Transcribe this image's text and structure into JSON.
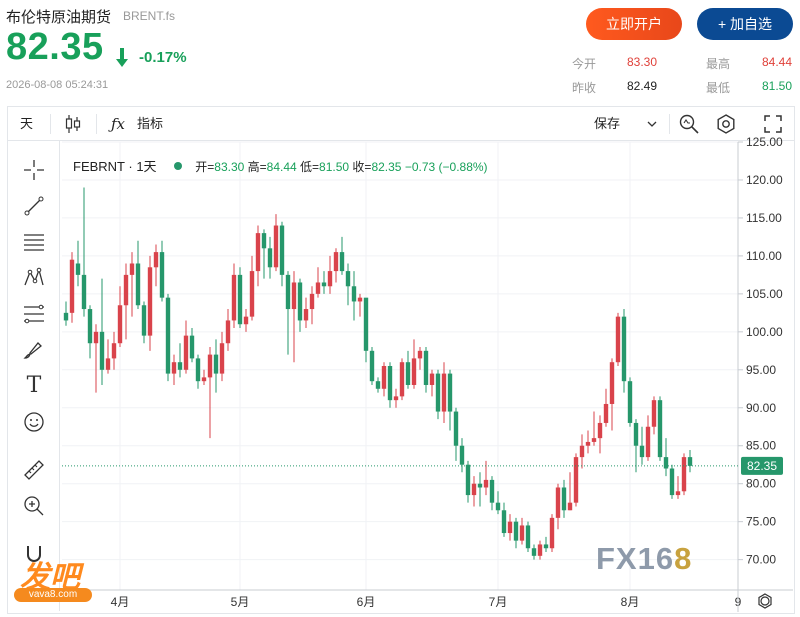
{
  "header": {
    "name": "布伦特原油期货",
    "code": "BRENT.fs",
    "price": "82.35",
    "change_pct": "-0.17%",
    "timestamp": "2026-08-08 05:24:31",
    "open_button": "立即开户",
    "watch_button": "+ 加自选"
  },
  "quote": {
    "open_label": "今开",
    "open": "83.30",
    "prev_label": "昨收",
    "prev": "82.49",
    "high_label": "最高",
    "high": "84.44",
    "low_label": "最低",
    "low": "81.50"
  },
  "toolbar": {
    "period": "天",
    "indicator_label": "指标",
    "save_label": "保存"
  },
  "legend": {
    "symbol": "FEBRNT · 1天",
    "open_label": "开=",
    "open": "83.30",
    "high_label": "高=",
    "high": "84.44",
    "low_label": "低=",
    "low": "81.50",
    "close_label": "收=",
    "close": "82.35",
    "change": "−0.73 (−0.88%)"
  },
  "watermarks": {
    "fx_left": "FX16",
    "fx_right": "8",
    "fa": "发吧",
    "fa_url": "vava8.com"
  },
  "colors": {
    "up": "#d9434b",
    "down": "#26976b",
    "accent": "#18a05a",
    "open_btn": "#ff5a1e",
    "watch_btn": "#0b4a93"
  },
  "chart_data": {
    "type": "candlestick",
    "ylim": [
      66,
      125
    ],
    "y_ticks": [
      "125.00",
      "120.00",
      "115.00",
      "110.00",
      "105.00",
      "100.00",
      "95.00",
      "90.00",
      "85.00",
      "80.00",
      "75.00",
      "70.00"
    ],
    "x_ticks": [
      {
        "label": "4月",
        "i": 9
      },
      {
        "label": "5月",
        "i": 29
      },
      {
        "label": "6月",
        "i": 50
      },
      {
        "label": "7月",
        "i": 72
      },
      {
        "label": "8月",
        "i": 94
      },
      {
        "label": "9",
        "i": 112
      }
    ],
    "last_price": "82.35",
    "last_value": 82.35,
    "candles": [
      [
        102.5,
        101.5,
        104.0,
        100.8
      ],
      [
        102.5,
        109.5,
        110.5,
        101.2
      ],
      [
        109.0,
        107.5,
        112.0,
        106.0
      ],
      [
        107.5,
        103.0,
        119.0,
        102.0
      ],
      [
        103.0,
        98.5,
        103.5,
        96.5
      ],
      [
        98.5,
        100.0,
        101.0,
        92.0
      ],
      [
        100.0,
        95.0,
        107.0,
        93.0
      ],
      [
        95.0,
        96.5,
        99.0,
        94.5
      ],
      [
        96.5,
        98.5,
        100.0,
        95.0
      ],
      [
        98.5,
        103.5,
        106.0,
        98.0
      ],
      [
        103.5,
        107.5,
        109.0,
        99.0
      ],
      [
        107.5,
        109.0,
        110.5,
        102.0
      ],
      [
        109.0,
        103.5,
        112.0,
        103.0
      ],
      [
        103.5,
        99.5,
        104.0,
        98.5
      ],
      [
        99.5,
        108.5,
        110.0,
        97.5
      ],
      [
        108.5,
        110.5,
        111.5,
        106.0
      ],
      [
        110.5,
        104.5,
        112.0,
        104.0
      ],
      [
        104.5,
        94.5,
        105.0,
        93.5
      ],
      [
        94.5,
        96.0,
        97.0,
        93.0
      ],
      [
        96.0,
        95.0,
        98.5,
        94.0
      ],
      [
        95.0,
        99.5,
        101.5,
        94.5
      ],
      [
        99.5,
        96.5,
        100.5,
        96.0
      ],
      [
        96.5,
        93.5,
        97.0,
        92.5
      ],
      [
        93.5,
        94.0,
        95.0,
        93.0
      ],
      [
        94.0,
        97.0,
        98.0,
        86.0
      ],
      [
        97.0,
        94.5,
        99.0,
        92.0
      ],
      [
        94.5,
        98.5,
        100.0,
        93.5
      ],
      [
        98.5,
        101.5,
        103.0,
        97.5
      ],
      [
        101.5,
        107.5,
        109.0,
        100.5
      ],
      [
        107.5,
        101.0,
        108.5,
        100.5
      ],
      [
        101.0,
        102.0,
        103.0,
        100.0
      ],
      [
        102.0,
        108.0,
        110.0,
        101.5
      ],
      [
        108.0,
        113.0,
        114.0,
        106.0
      ],
      [
        113.0,
        111.0,
        113.5,
        107.0
      ],
      [
        111.0,
        108.5,
        112.5,
        107.0
      ],
      [
        108.5,
        114.0,
        115.5,
        108.0
      ],
      [
        114.0,
        107.5,
        114.5,
        106.0
      ],
      [
        107.5,
        103.0,
        108.0,
        97.0
      ],
      [
        103.0,
        106.5,
        108.0,
        96.0
      ],
      [
        106.5,
        101.5,
        107.0,
        100.0
      ],
      [
        101.5,
        103.0,
        104.5,
        100.5
      ],
      [
        103.0,
        105.0,
        106.0,
        101.0
      ],
      [
        105.0,
        106.5,
        108.5,
        104.5
      ],
      [
        106.5,
        106.0,
        108.0,
        105.0
      ],
      [
        106.0,
        108.0,
        110.0,
        105.0
      ],
      [
        108.0,
        110.5,
        111.0,
        106.5
      ],
      [
        110.5,
        108.0,
        112.5,
        107.5
      ],
      [
        108.0,
        106.0,
        109.0,
        103.5
      ],
      [
        106.0,
        104.0,
        108.0,
        101.5
      ],
      [
        104.0,
        104.5,
        105.0,
        102.0
      ],
      [
        104.5,
        97.5,
        98.5,
        96.0
      ],
      [
        97.5,
        93.5,
        98.0,
        93.0
      ],
      [
        93.5,
        92.5,
        94.0,
        92.0
      ],
      [
        92.5,
        95.5,
        96.0,
        91.5
      ],
      [
        95.5,
        91.0,
        96.0,
        90.0
      ],
      [
        91.0,
        91.5,
        92.5,
        90.0
      ],
      [
        91.5,
        96.0,
        96.5,
        91.0
      ],
      [
        96.0,
        93.0,
        97.5,
        92.5
      ],
      [
        93.0,
        96.5,
        99.0,
        92.5
      ],
      [
        96.5,
        97.5,
        98.0,
        95.0
      ],
      [
        97.5,
        93.0,
        98.0,
        92.0
      ],
      [
        93.0,
        94.5,
        95.0,
        91.5
      ],
      [
        94.5,
        89.5,
        95.0,
        88.5
      ],
      [
        89.5,
        94.5,
        96.0,
        88.0
      ],
      [
        94.5,
        89.5,
        95.0,
        87.0
      ],
      [
        89.5,
        85.0,
        90.0,
        83.0
      ],
      [
        85.0,
        82.5,
        86.0,
        81.5
      ],
      [
        82.5,
        78.5,
        83.0,
        77.5
      ],
      [
        78.5,
        80.0,
        81.0,
        77.0
      ],
      [
        80.0,
        79.5,
        81.5,
        77.0
      ],
      [
        79.5,
        80.5,
        83.0,
        78.5
      ],
      [
        80.5,
        77.5,
        81.0,
        76.5
      ],
      [
        77.5,
        76.5,
        79.0,
        76.0
      ],
      [
        76.5,
        73.5,
        77.5,
        73.0
      ],
      [
        73.5,
        75.0,
        76.0,
        72.5
      ],
      [
        75.0,
        72.5,
        75.5,
        71.5
      ],
      [
        72.5,
        74.5,
        75.5,
        72.0
      ],
      [
        74.5,
        71.5,
        75.0,
        71.0
      ],
      [
        71.5,
        70.5,
        72.0,
        70.0
      ],
      [
        70.5,
        72.0,
        72.5,
        70.0
      ],
      [
        72.0,
        71.5,
        73.0,
        71.0
      ],
      [
        71.5,
        75.5,
        76.0,
        71.0
      ],
      [
        75.5,
        79.5,
        80.0,
        74.0
      ],
      [
        79.5,
        76.5,
        80.5,
        75.5
      ],
      [
        76.5,
        77.5,
        81.5,
        76.5
      ],
      [
        77.5,
        83.5,
        84.0,
        77.0
      ],
      [
        83.5,
        85.0,
        86.5,
        82.0
      ],
      [
        85.0,
        85.5,
        87.0,
        84.0
      ],
      [
        85.5,
        86.0,
        89.5,
        85.0
      ],
      [
        86.0,
        88.0,
        89.0,
        84.0
      ],
      [
        88.0,
        90.5,
        92.5,
        87.5
      ],
      [
        90.5,
        96.0,
        96.5,
        87.0
      ],
      [
        96.0,
        102.0,
        102.5,
        95.5
      ],
      [
        102.0,
        93.5,
        103.0,
        92.0
      ],
      [
        93.5,
        88.0,
        94.0,
        87.5
      ],
      [
        88.0,
        85.0,
        88.5,
        81.5
      ],
      [
        85.0,
        83.5,
        87.5,
        82.5
      ],
      [
        83.5,
        87.5,
        89.0,
        83.0
      ],
      [
        87.5,
        91.0,
        91.5,
        86.5
      ],
      [
        91.0,
        83.5,
        91.5,
        83.0
      ],
      [
        83.5,
        82.0,
        86.0,
        81.0
      ],
      [
        82.0,
        78.5,
        82.5,
        78.0
      ],
      [
        78.5,
        79.0,
        81.0,
        78.0
      ],
      [
        79.0,
        83.5,
        84.0,
        78.5
      ],
      [
        83.5,
        82.35,
        84.44,
        81.5
      ]
    ]
  }
}
